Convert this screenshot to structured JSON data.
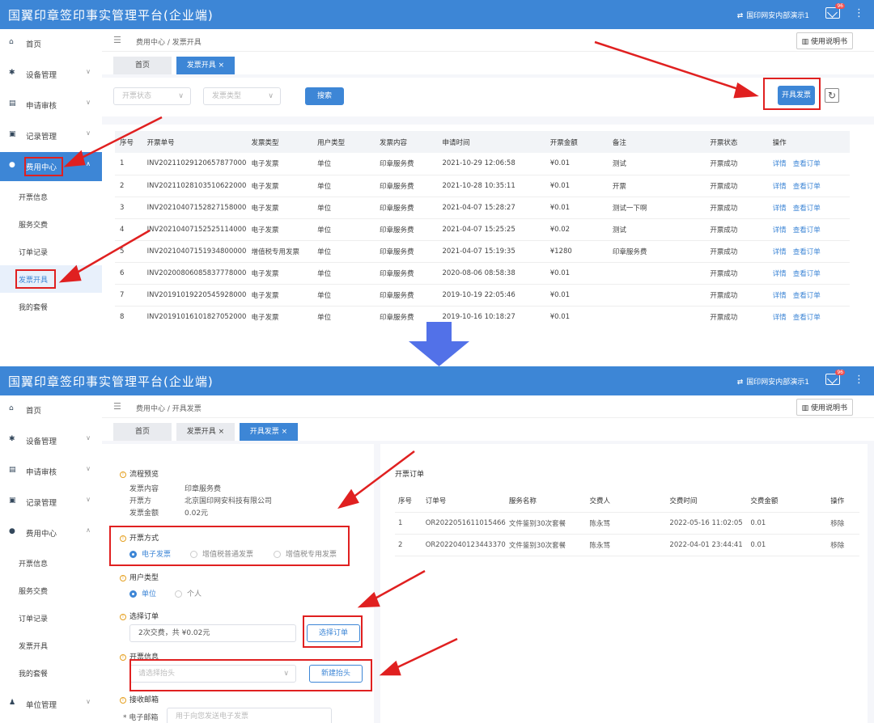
{
  "app": {
    "title": "国翼印章签印事实管理平台(企业端)",
    "account": "国印网安内部演示1",
    "badge": "96",
    "manual": "使用说明书",
    "colors": {
      "header": "#3d86d6",
      "accent": "#3d86d6",
      "annotation": "#e02020"
    }
  },
  "sidebar": {
    "items": [
      {
        "label": "首页",
        "icon": "home-icon"
      },
      {
        "label": "设备管理",
        "icon": "gear-icon"
      },
      {
        "label": "申请审核",
        "icon": "document-icon"
      },
      {
        "label": "记录管理",
        "icon": "list-icon"
      },
      {
        "label": "费用中心",
        "icon": "billing-icon"
      },
      {
        "label": "单位管理",
        "icon": "users-icon"
      }
    ],
    "sub_items": [
      {
        "label": "开票信息"
      },
      {
        "label": "服务交费"
      },
      {
        "label": "订单记录"
      },
      {
        "label": "发票开具"
      },
      {
        "label": "我的套餐"
      }
    ]
  },
  "view1": {
    "breadcrumb": {
      "root": "费用中心",
      "current": "发票开具"
    },
    "tabs": [
      {
        "label": "首页"
      },
      {
        "label": "发票开具 ×"
      }
    ],
    "filters": {
      "status_placeholder": "开票状态",
      "type_placeholder": "发票类型",
      "search": "搜索"
    },
    "issue_button": "开具发票",
    "table": {
      "headers": [
        "序号",
        "开票单号",
        "发票类型",
        "用户类型",
        "发票内容",
        "申请时间",
        "开票金额",
        "备注",
        "开票状态",
        "操作"
      ],
      "rows": [
        {
          "no": "1",
          "id": "INV20211029120657877000",
          "type": "电子发票",
          "user": "单位",
          "content": "印章服务费",
          "time": "2021-10-29 12:06:58",
          "amount": "¥0.01",
          "note": "测试",
          "status": "开票成功",
          "detail": "详情",
          "view": "查看订单"
        },
        {
          "no": "2",
          "id": "INV20211028103510622000",
          "type": "电子发票",
          "user": "单位",
          "content": "印章服务费",
          "time": "2021-10-28 10:35:11",
          "amount": "¥0.01",
          "note": "开票",
          "status": "开票成功",
          "detail": "详情",
          "view": "查看订单"
        },
        {
          "no": "3",
          "id": "INV20210407152827158000",
          "type": "电子发票",
          "user": "单位",
          "content": "印章服务费",
          "time": "2021-04-07 15:28:27",
          "amount": "¥0.01",
          "note": "测试一下啊",
          "status": "开票成功",
          "detail": "详情",
          "view": "查看订单"
        },
        {
          "no": "4",
          "id": "INV20210407152525114000",
          "type": "电子发票",
          "user": "单位",
          "content": "印章服务费",
          "time": "2021-04-07 15:25:25",
          "amount": "¥0.02",
          "note": "测试",
          "status": "开票成功",
          "detail": "详情",
          "view": "查看订单"
        },
        {
          "no": "5",
          "id": "INV20210407151934800000",
          "type": "增值税专用发票",
          "user": "单位",
          "content": "印章服务费",
          "time": "2021-04-07 15:19:35",
          "amount": "¥1280",
          "note": "印章服务费",
          "status": "开票成功",
          "detail": "详情",
          "view": "查看订单"
        },
        {
          "no": "6",
          "id": "INV20200806085837778000",
          "type": "电子发票",
          "user": "单位",
          "content": "印章服务费",
          "time": "2020-08-06 08:58:38",
          "amount": "¥0.01",
          "note": "",
          "status": "开票成功",
          "detail": "详情",
          "view": "查看订单"
        },
        {
          "no": "7",
          "id": "INV20191019220545928000",
          "type": "电子发票",
          "user": "单位",
          "content": "印章服务费",
          "time": "2019-10-19 22:05:46",
          "amount": "¥0.01",
          "note": "",
          "status": "开票成功",
          "detail": "详情",
          "view": "查看订单"
        },
        {
          "no": "8",
          "id": "INV20191016101827052000",
          "type": "电子发票",
          "user": "单位",
          "content": "印章服务费",
          "time": "2019-10-16 10:18:27",
          "amount": "¥0.01",
          "note": "",
          "status": "开票成功",
          "detail": "详情",
          "view": "查看订单"
        }
      ]
    }
  },
  "view2": {
    "breadcrumb": {
      "root": "费用中心",
      "current": "开具发票"
    },
    "tabs": [
      {
        "label": "首页"
      },
      {
        "label": "发票开具 ×"
      },
      {
        "label": "开具发票 ×"
      }
    ],
    "preview": {
      "title": "流程预览",
      "rows": [
        {
          "key": "发票内容",
          "value": "印章服务费"
        },
        {
          "key": "开票方",
          "value": "北京国印网安科技有限公司"
        },
        {
          "key": "发票金额",
          "value": "0.02元"
        }
      ]
    },
    "method": {
      "title": "开票方式",
      "options": [
        "电子发票",
        "增值税普通发票",
        "增值税专用发票"
      ],
      "selected": "电子发票"
    },
    "user_type": {
      "title": "用户类型",
      "options": [
        "单位",
        "个人"
      ],
      "selected": "单位"
    },
    "select_order": {
      "title": "选择订单",
      "value": "2次交费，共 ¥0.02元",
      "button": "选择订单"
    },
    "invoice_info": {
      "title": "开票信息",
      "placeholder": "请选择抬头",
      "button": "新建抬头"
    },
    "email": {
      "title": "接收邮箱",
      "label": "* 电子邮箱",
      "placeholder": "用于向您发送电子发票"
    },
    "orders": {
      "title": "开票订单",
      "headers": [
        "序号",
        "订单号",
        "服务名称",
        "交费人",
        "交费时间",
        "交费金额",
        "操作"
      ],
      "rows": [
        {
          "no": "1",
          "id": "OR2022051611015466",
          "service": "文件鉴别30次套餐",
          "payer": "陈永骂",
          "time": "2022-05-16 11:02:05",
          "amount": "0.01",
          "op": "移除"
        },
        {
          "no": "2",
          "id": "OR2022040123443370",
          "service": "文件鉴别30次套餐",
          "payer": "陈永骂",
          "time": "2022-04-01 23:44:41",
          "amount": "0.01",
          "op": "移除"
        }
      ]
    }
  }
}
